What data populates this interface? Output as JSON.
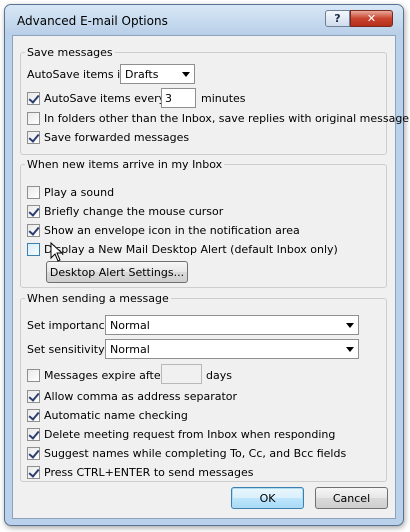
{
  "window": {
    "title": "Advanced E-mail Options",
    "help_glyph": "?",
    "close_glyph": "✕"
  },
  "save_messages": {
    "label": "Save messages",
    "autosave_in_label": "AutoSave items in:",
    "autosave_in_value": "Drafts",
    "autosave_every_label": "AutoSave items every:",
    "autosave_every_checked": true,
    "autosave_every_value": "3",
    "minutes_label": "minutes",
    "other_folders_label": "In folders other than the Inbox, save replies with original message",
    "other_folders_checked": false,
    "save_forwarded_label": "Save forwarded messages",
    "save_forwarded_checked": true
  },
  "new_items": {
    "label": "When new items arrive in my Inbox",
    "play_sound_label": "Play a sound",
    "play_sound_checked": false,
    "change_cursor_label": "Briefly change the mouse cursor",
    "change_cursor_checked": true,
    "envelope_icon_label": "Show an envelope icon in the notification area",
    "envelope_icon_checked": true,
    "desktop_alert_label": "Display a New Mail Desktop Alert (default Inbox only)",
    "desktop_alert_checked": false,
    "alert_settings_button": "Desktop Alert Settings..."
  },
  "sending": {
    "label": "When sending a message",
    "importance_label": "Set importance:",
    "importance_value": "Normal",
    "sensitivity_label": "Set sensitivity:",
    "sensitivity_value": "Normal",
    "expire_label": "Messages expire after:",
    "expire_checked": false,
    "expire_value": "",
    "days_label": "days",
    "comma_label": "Allow comma as address separator",
    "comma_checked": true,
    "name_check_label": "Automatic name checking",
    "name_check_checked": true,
    "delete_meeting_label": "Delete meeting request from Inbox when responding",
    "delete_meeting_checked": true,
    "suggest_names_label": "Suggest names while completing To, Cc, and Bcc fields",
    "suggest_names_checked": true,
    "ctrl_enter_label": "Press CTRL+ENTER to send messages",
    "ctrl_enter_checked": true
  },
  "buttons": {
    "ok": "OK",
    "cancel": "Cancel"
  }
}
